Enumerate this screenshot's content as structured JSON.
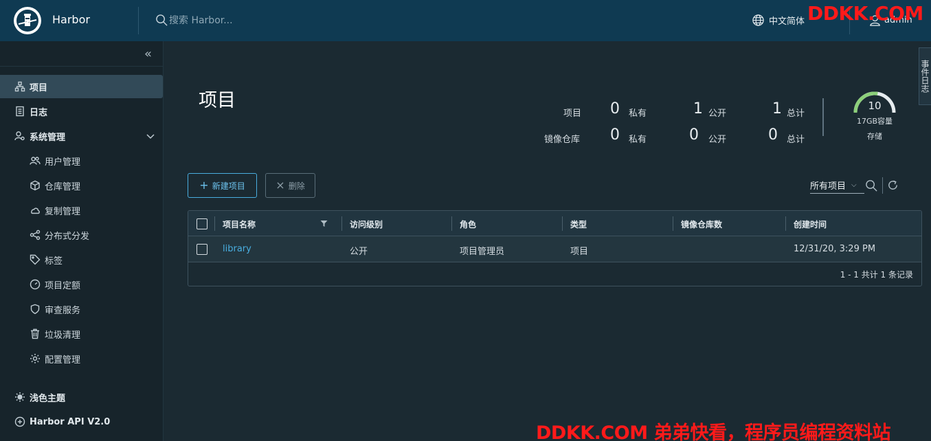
{
  "header": {
    "brand": "Harbor",
    "search_placeholder": "搜索 Harbor...",
    "language": "中文简体",
    "user": "admin"
  },
  "watermark": {
    "top": "DDKK.COM",
    "bottom": "DDKK.COM 弟弟快看，程序员编程资料站"
  },
  "sidebar": {
    "items": [
      {
        "label": "项目",
        "icon": "projects-icon",
        "active": true
      },
      {
        "label": "日志",
        "icon": "log-icon"
      },
      {
        "label": "系统管理",
        "icon": "admin-icon"
      }
    ],
    "sub_items": [
      {
        "label": "用户管理",
        "icon": "users-icon"
      },
      {
        "label": "仓库管理",
        "icon": "cube-icon"
      },
      {
        "label": "复制管理",
        "icon": "cloud-icon"
      },
      {
        "label": "分布式分发",
        "icon": "share-icon"
      },
      {
        "label": "标签",
        "icon": "tag-icon"
      },
      {
        "label": "项目定额",
        "icon": "dashboard-icon"
      },
      {
        "label": "审查服务",
        "icon": "shield-icon"
      },
      {
        "label": "垃圾清理",
        "icon": "trash-icon"
      },
      {
        "label": "配置管理",
        "icon": "gear-icon"
      }
    ],
    "bottom_items": [
      {
        "label": "浅色主题",
        "icon": "sun-icon"
      },
      {
        "label": "Harbor API V2.0",
        "icon": "api-icon"
      }
    ]
  },
  "main": {
    "title": "项目",
    "stats": {
      "rows": [
        {
          "label": "项目",
          "private": "0",
          "public": "1",
          "total": "1"
        },
        {
          "label": "镜像仓库",
          "private": "0",
          "public": "0",
          "total": "0"
        }
      ],
      "private_label": "私有",
      "public_label": "公开",
      "total_label": "总计"
    },
    "storage": {
      "value": "10",
      "capacity": "17GB容量",
      "label": "存储",
      "fill_fraction": 0.55
    },
    "side_tab": "事件日志",
    "buttons": {
      "new_project": "新建项目",
      "delete": "删除"
    },
    "filter": "所有项目",
    "table": {
      "headers": [
        "项目名称",
        "访问级别",
        "角色",
        "类型",
        "镜像仓库数",
        "创建时间"
      ],
      "rows": [
        [
          "library",
          "公开",
          "项目管理员",
          "项目",
          "",
          "12/31/20, 3:29 PM"
        ]
      ],
      "footer": "1 - 1 共计 1 条记录"
    }
  },
  "colors": {
    "header_bg": "#0f3a52",
    "sidebar_bg": "#17242b",
    "content_bg": "#1b2a32",
    "accent": "#49aee0",
    "gauge_fill": "#8ccf7a"
  }
}
